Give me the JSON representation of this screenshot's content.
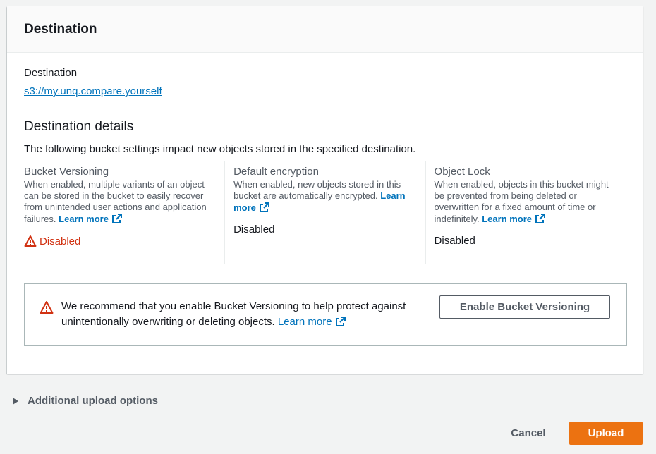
{
  "section": {
    "title": "Destination",
    "destination_label": "Destination",
    "destination_link": "s3://my.unq.compare.yourself",
    "details_title": "Destination details",
    "details_desc": "The following bucket settings impact new objects stored in the specified destination."
  },
  "settings": [
    {
      "title": "Bucket Versioning",
      "desc": "When enabled, multiple variants of an object can be stored in the bucket to easily recover from unintended user actions and application failures.",
      "learn_more": "Learn more",
      "status": "Disabled",
      "status_icon": "warning-icon"
    },
    {
      "title": "Default encryption",
      "desc": "When enabled, new objects stored in this bucket are automatically encrypted.",
      "learn_more": "Learn more",
      "status": "Disabled"
    },
    {
      "title": "Object Lock",
      "desc": "When enabled, objects in this bucket might be prevented from being deleted or overwritten for a fixed amount of time or indefinitely.",
      "learn_more": "Learn more",
      "status": "Disabled"
    }
  ],
  "alert": {
    "text": "We recommend that you enable Bucket Versioning to help protect against unintentionally overwriting or deleting objects.",
    "learn_more": "Learn more",
    "button": "Enable Bucket Versioning"
  },
  "additional_options": "Additional upload options",
  "footer": {
    "cancel": "Cancel",
    "upload": "Upload"
  },
  "colors": {
    "link": "#0073bb",
    "warning": "#d13212",
    "primary": "#ec7211"
  }
}
